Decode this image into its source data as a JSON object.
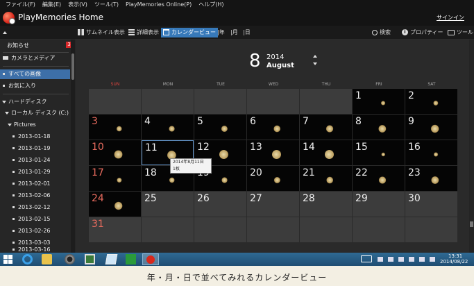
{
  "menu": [
    "ファイル(F)",
    "編集(E)",
    "表示(V)",
    "ツール(T)",
    "PlayMemories Online(P)",
    "ヘルプ(H)"
  ],
  "app": {
    "title": "PlayMemories Home",
    "signin": "サインイン"
  },
  "toolbar": {
    "thumbnail": "サムネイル表示",
    "detail": "詳細表示",
    "calendar": "カレンダービュー",
    "year": "年",
    "month": "月",
    "day": "日",
    "search": "検索",
    "properties": "プロパティー",
    "tools": "ツール"
  },
  "sidebar": {
    "notice": "お知らせ",
    "notice_count": "3",
    "camera_media": "カメラとメディア",
    "all_images": "すべての画像",
    "favorites": "お気に入り",
    "hard_disk": "ハードディスク",
    "local_disk": "ローカル ディスク (C:)",
    "pictures": "Pictures",
    "folders": [
      "2013-01-18",
      "2013-01-19",
      "2013-01-24",
      "2013-01-29",
      "2013-02-01",
      "2013-02-06",
      "2013-02-12",
      "2013-02-15",
      "2013-02-26",
      "2013-03-03",
      "2013-03-16"
    ]
  },
  "calendar": {
    "month_number": "8",
    "year": "2014",
    "month_name": "August",
    "weekdays": [
      "SUN",
      "MON",
      "TUE",
      "WED",
      "THU",
      "FRI",
      "SAT"
    ],
    "days": [
      "1",
      "2",
      "3",
      "4",
      "5",
      "6",
      "7",
      "8",
      "9",
      "10",
      "11",
      "12",
      "13",
      "14",
      "15",
      "16",
      "17",
      "18",
      "19",
      "20",
      "21",
      "22",
      "23",
      "24",
      "25",
      "26",
      "27",
      "28",
      "29",
      "30",
      "31"
    ],
    "photo_days": [
      1,
      2,
      3,
      4,
      5,
      6,
      7,
      8,
      9,
      10,
      11,
      12,
      13,
      14,
      15,
      16,
      17,
      18,
      19,
      20,
      21,
      22,
      23,
      24
    ],
    "selected_day": 11,
    "tooltip_date": "2014年8月11日",
    "tooltip_count": "1枚"
  },
  "taskbar": {
    "time": "13:31",
    "date": "2014/08/22"
  },
  "caption": "年・月・日で並べてみれるカレンダービュー"
}
